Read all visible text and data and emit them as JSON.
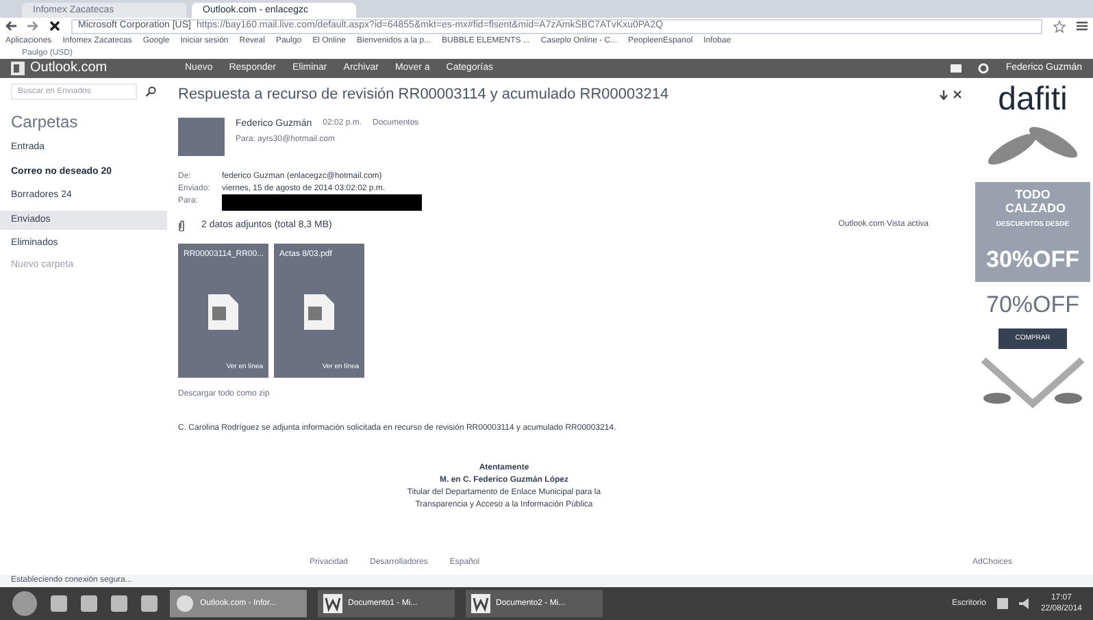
{
  "browser": {
    "tabs": [
      {
        "label": "Infomex Zacatecas",
        "selected": false
      },
      {
        "label": "Outlook.com - enlacegzc",
        "selected": true
      }
    ],
    "address": {
      "site": "Microsoft Corporation [US]",
      "url": "https://bay160.mail.live.com/default.aspx?id=64855&mkt=es-mx#fid=flsent&mid=A7zAmkSBC7ATvKxu0PA2Q"
    },
    "bookmarks": [
      "Aplicaciones",
      "Infomex Zacatecas",
      "Google",
      "Iniciar sesión",
      "Reveal",
      "Paulgo",
      "El Online",
      "Bienvenidos a la p...",
      "BUBBLE ELEMENTS ...",
      "Caseplo Online - C...",
      "PeopleenEspanol",
      "Infobae"
    ],
    "extra_bar": "Paulgo (USD)"
  },
  "outlook": {
    "logo": "Outlook.com",
    "toolbar": [
      "Nuevo",
      "Responder",
      "Eliminar",
      "Archivar",
      "Mover a",
      "Categorías"
    ],
    "user": "Federico Guzmán"
  },
  "sidebar": {
    "search_placeholder": "Buscar en Enviados",
    "heading": "Carpetas",
    "folders": [
      {
        "label": "Entrada",
        "selected": false,
        "bold": false
      },
      {
        "label": "Correo no deseado",
        "count": "20",
        "selected": false,
        "bold": true
      },
      {
        "label": "Borradores",
        "count": "24",
        "selected": false,
        "bold": false
      },
      {
        "label": "Enviados",
        "selected": true,
        "bold": false
      },
      {
        "label": "Eliminados",
        "selected": false,
        "bold": false
      }
    ],
    "new_folder": "Nuevo carpeta"
  },
  "message": {
    "subject": "Respuesta a recurso de revisión RR00003114 y acumulado RR00003214",
    "sender": "Federico Guzmán",
    "time": "02:02 p.m.",
    "folder": "Documentos",
    "to_line": "Para: ayrs30@hotmail.com",
    "headers": [
      {
        "label": "De:",
        "value": "federico Guzman (enlacegzc@hotmail.com)"
      },
      {
        "label": "Enviado:",
        "value": "viernes, 15 de agosto de 2014 03:02:02 p.m."
      },
      {
        "label": "Para:",
        "redacted": true
      }
    ],
    "attach_summary": "2 datos adjuntos (total 8,3 MB)",
    "view_link": "Outlook.com Vista activa",
    "attachments": [
      {
        "name": "RR00003114_RR00...",
        "action": "Ver en línea"
      },
      {
        "name": "Actas 8/03.pdf",
        "action": "Ver en línea"
      }
    ],
    "download_all": "Descargar todo como zip",
    "body": "C. Carolina Rodríguez se adjunta información solicitada en recurso de revisión RR00003114 y acumulado RR00003214.",
    "signature": [
      "Atentamente",
      "M. en C. Federico Guzmán López",
      "Titular del Departamento de Enlace Municipal para la",
      "Transparencia y Acceso a la Información Pública"
    ]
  },
  "ad": {
    "brand": "dafiti",
    "tagline": "TODO CALZADO",
    "sub": "DESCUENTOS DESDE",
    "offer1": "30%OFF",
    "offer2": "70%OFF",
    "button": "COMPRAR",
    "choices": "AdChoices"
  },
  "footer": {
    "links": [
      "Privacidad",
      "Desarrolladores",
      "Español"
    ],
    "status": "Estableciendo conexión segura..."
  },
  "taskbar": {
    "apps": [
      {
        "label": "Outlook.com - Infor...",
        "kind": "browser",
        "selected": true
      },
      {
        "label": "Documento1 - Mi...",
        "kind": "word",
        "selected": false
      },
      {
        "label": "Documento2 - Mi...",
        "kind": "word",
        "selected": false
      }
    ],
    "tray": "Escritorio",
    "time": "17:07",
    "date": "22/08/2014"
  }
}
